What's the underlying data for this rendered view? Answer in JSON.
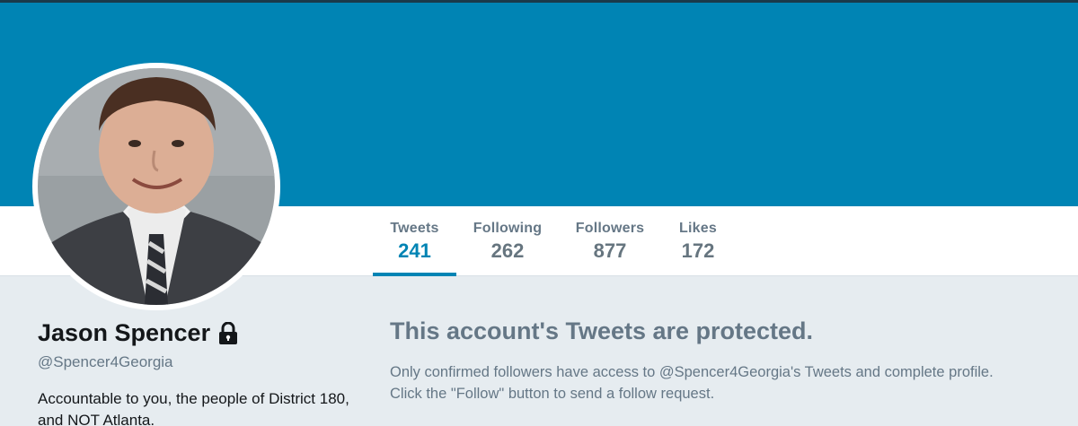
{
  "nav": {
    "items": [
      {
        "label": "Tweets",
        "value": "241"
      },
      {
        "label": "Following",
        "value": "262"
      },
      {
        "label": "Followers",
        "value": "877"
      },
      {
        "label": "Likes",
        "value": "172"
      }
    ],
    "active": "Tweets"
  },
  "profile": {
    "name": "Jason Spencer",
    "handle": "@Spencer4Georgia",
    "bio": "Accountable to you, the people of District 180, and NOT Atlanta.",
    "protected_icon": "lock-icon"
  },
  "main": {
    "title": "This account's Tweets are protected.",
    "message_line1": "Only confirmed followers have access to @Spencer4Georgia's Tweets and complete profile.",
    "message_line2": "Click the \"Follow\" button to send a follow request."
  },
  "colors": {
    "banner": "#0084b4",
    "accent": "#0084b4",
    "background": "#e6ecf0",
    "muted_text": "#657786"
  }
}
